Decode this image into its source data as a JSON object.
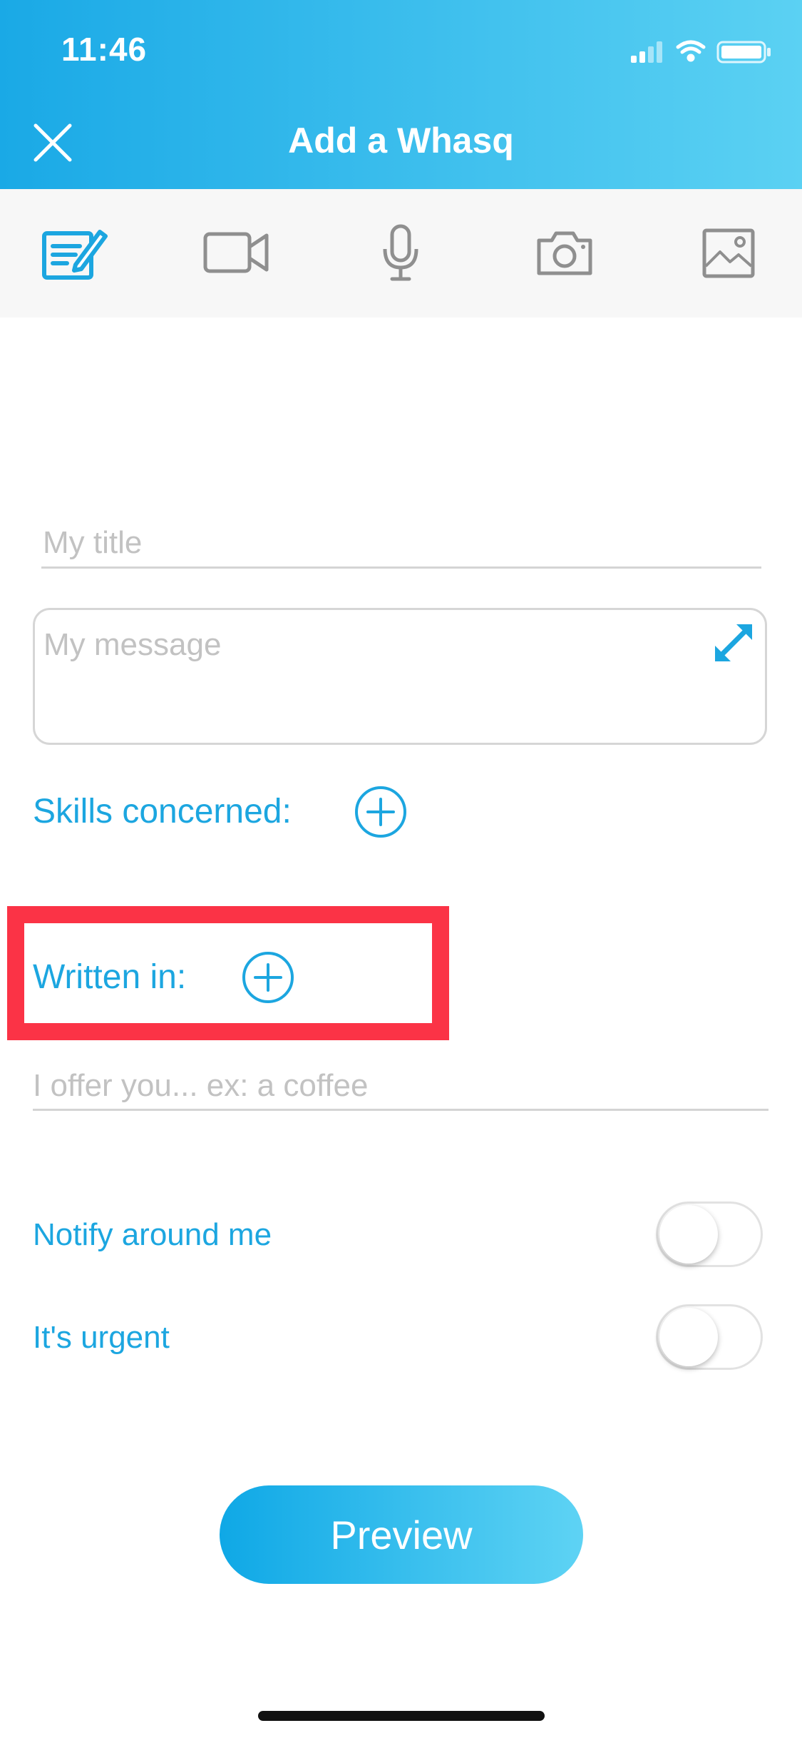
{
  "status_bar": {
    "time": "11:46"
  },
  "header": {
    "title": "Add a Whasq"
  },
  "toolbar": {
    "items": [
      {
        "icon": "edit-note-icon",
        "active": true
      },
      {
        "icon": "video-camera-icon",
        "active": false
      },
      {
        "icon": "microphone-icon",
        "active": false
      },
      {
        "icon": "camera-icon",
        "active": false
      },
      {
        "icon": "image-icon",
        "active": false
      }
    ]
  },
  "form": {
    "title_placeholder": "My title",
    "message_placeholder": "My message",
    "skills_label": "Skills concerned:",
    "written_in_label": "Written in:",
    "reward_placeholder": "I offer you... ex: a coffee",
    "notify_label": "Notify around me",
    "notify_on": false,
    "urgent_label": "It's urgent",
    "urgent_on": false,
    "preview_label": "Preview"
  },
  "colors": {
    "accent": "#1ca6e0",
    "header_start": "#1aa9e6",
    "header_end": "#5bd1f3",
    "highlight": "#fb3346"
  }
}
